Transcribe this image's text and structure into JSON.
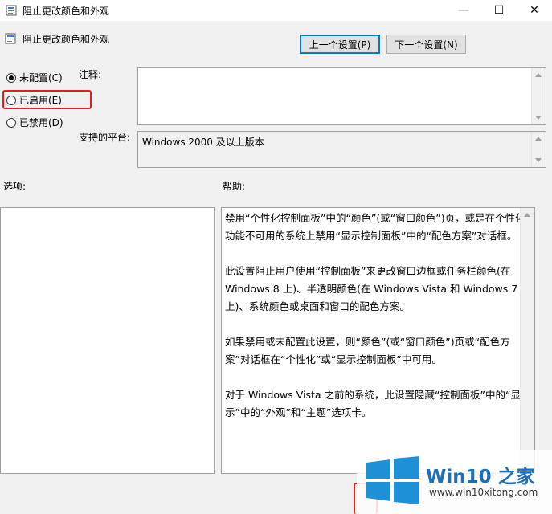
{
  "window": {
    "title": "阻止更改颜色和外观",
    "minimize_glyph": "—",
    "maximize_glyph": "☐",
    "close_glyph": "✕"
  },
  "policy": {
    "title": "阻止更改颜色和外观",
    "prev_button": "上一个设置(P)",
    "next_button": "下一个设置(N)"
  },
  "state": {
    "options": [
      {
        "label": "未配置(C)",
        "checked": true
      },
      {
        "label": "已启用(E)",
        "checked": false
      },
      {
        "label": "已禁用(D)",
        "checked": false
      }
    ]
  },
  "comment": {
    "label": "注释:",
    "value": ""
  },
  "platform": {
    "label": "支持的平台:",
    "value": "Windows 2000 及以上版本"
  },
  "options_section": {
    "label": "选项:"
  },
  "help_section": {
    "label": "帮助:",
    "text": "禁用“个性化控制面板”中的“颜色”(或“窗口颜色”)页，或是在个性化功能不可用的系统上禁用“显示控制面板”中的“配色方案”对话框。\n\n此设置阻止用户使用“控制面板”来更改窗口边框或任务栏颜色(在 Windows 8 上)、半透明颜色(在 Windows Vista 和 Windows 7 上)、系统颜色或桌面和窗口的配色方案。\n\n如果禁用或未配置此设置，则“颜色”(或“窗口颜色”)页或“配色方案”对话框在“个性化”或“显示控制面板”中可用。\n\n对于 Windows Vista 之前的系统，此设置隐藏“控制面板”中的“显示”中的“外观”和“主题”选项卡。"
  },
  "watermark": {
    "brand": "Win10 之家",
    "url": "www.win10xitong.com"
  },
  "colors": {
    "accent": "#0078d7",
    "highlight": "#e02020",
    "logo": "#1e90d8"
  }
}
